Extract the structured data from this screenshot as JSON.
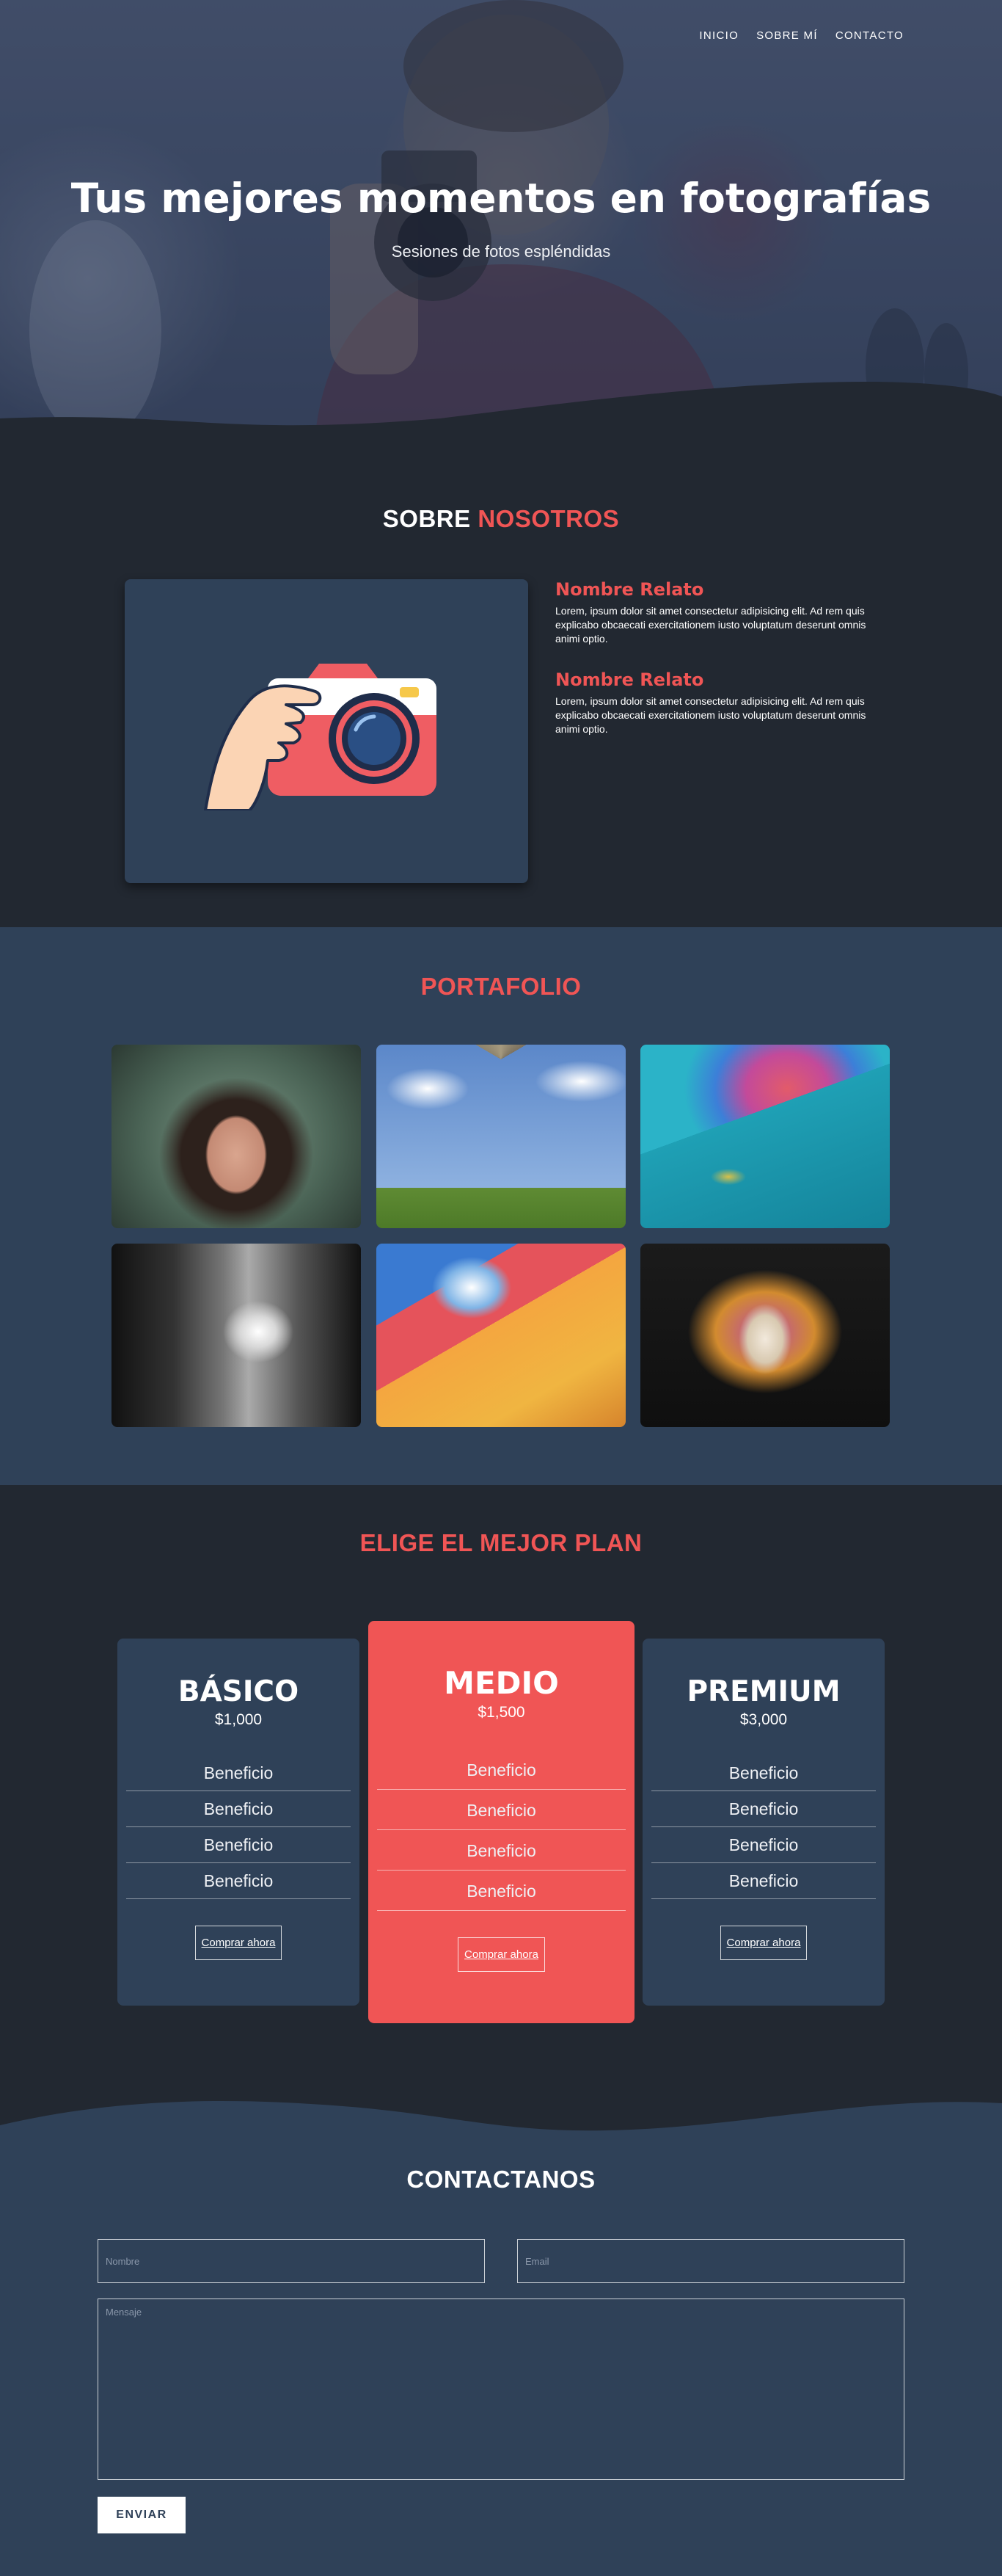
{
  "nav": {
    "items": [
      "INICIO",
      "SOBRE MÍ",
      "CONTACTO"
    ]
  },
  "hero": {
    "title": "Tus mejores momentos en fotografías",
    "subtitle": "Sesiones de fotos espléndidas"
  },
  "about": {
    "title_plain": "SOBRE",
    "title_accent": "NOSOTROS",
    "stories": [
      {
        "title": "Nombre Relato",
        "text": "Lorem, ipsum dolor sit amet consectetur adipisicing elit. Ad rem quis explicabo obcaecati exercitationem iusto voluptatum deserunt omnis animi optio."
      },
      {
        "title": "Nombre Relato",
        "text": "Lorem, ipsum dolor sit amet consectetur adipisicing elit. Ad rem quis explicabo obcaecati exercitationem iusto voluptatum deserunt omnis animi optio."
      }
    ]
  },
  "portfolio": {
    "title": "PORTAFOLIO"
  },
  "pricing": {
    "title": "ELIGE EL MEJOR PLAN",
    "plans": [
      {
        "name": "BÁSICO",
        "price": "$1,000",
        "benefits": [
          "Beneficio",
          "Beneficio",
          "Beneficio",
          "Beneficio"
        ],
        "cta": "Comprar ahora"
      },
      {
        "name": "MEDIO",
        "price": "$1,500",
        "benefits": [
          "Beneficio",
          "Beneficio",
          "Beneficio",
          "Beneficio"
        ],
        "cta": "Comprar ahora"
      },
      {
        "name": "PREMIUM",
        "price": "$3,000",
        "benefits": [
          "Beneficio",
          "Beneficio",
          "Beneficio",
          "Beneficio"
        ],
        "cta": "Comprar ahora"
      }
    ]
  },
  "contact": {
    "title": "CONTACTANOS",
    "name_placeholder": "Nombre",
    "email_placeholder": "Email",
    "message_placeholder": "Mensaje",
    "submit": "ENVIAR"
  },
  "colors": {
    "background": "#222831",
    "section": "#2f4158",
    "accent": "#f05555",
    "text": "#ffffff"
  }
}
